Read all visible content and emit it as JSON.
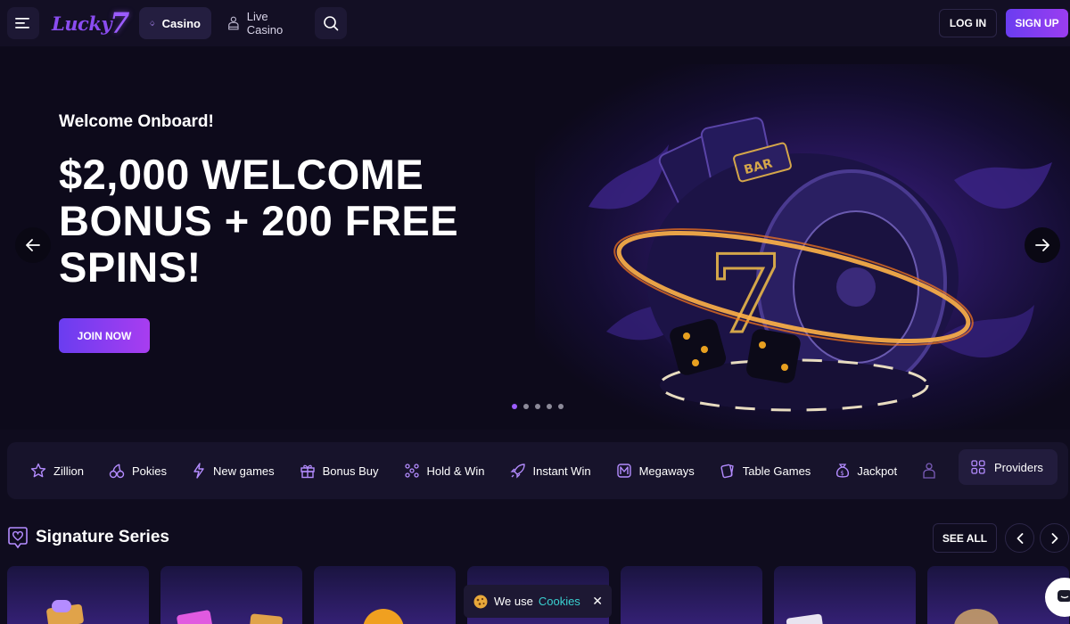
{
  "header": {
    "logo_text": "Lucky",
    "logo_seven": "7",
    "tabs": [
      {
        "label": "Casino",
        "active": true
      },
      {
        "label": "Live Casino",
        "active": false
      }
    ],
    "login_label": "LOG IN",
    "signup_label": "SIGN UP"
  },
  "hero": {
    "welcome": "Welcome Onboard!",
    "title_line1": "$2,000 WELCOME",
    "title_line2": "BONUS + 200 FREE",
    "title_line3": "SPINS!",
    "cta_label": "JOIN NOW",
    "slide_count": 5,
    "active_slide": 1
  },
  "categories": {
    "items": [
      {
        "label": "Zillion",
        "icon": "star-icon"
      },
      {
        "label": "Pokies",
        "icon": "cherry-icon"
      },
      {
        "label": "New games",
        "icon": "lightning-icon"
      },
      {
        "label": "Bonus Buy",
        "icon": "gift-icon"
      },
      {
        "label": "Hold & Win",
        "icon": "grid-dots-icon"
      },
      {
        "label": "Instant Win",
        "icon": "rocket-icon"
      },
      {
        "label": "Megaways",
        "icon": "megaways-icon"
      },
      {
        "label": "Table Games",
        "icon": "cards-icon"
      },
      {
        "label": "Jackpot",
        "icon": "money-bag-icon"
      }
    ],
    "providers_label": "Providers"
  },
  "signature": {
    "title": "Signature Series",
    "see_all_label": "SEE ALL"
  },
  "cookie": {
    "text": "We use",
    "link": "Cookies",
    "close": "✕"
  },
  "colors": {
    "accent": "#9b5cff",
    "background": "#0f0c1e",
    "cookie_link": "#3ad0d0"
  }
}
